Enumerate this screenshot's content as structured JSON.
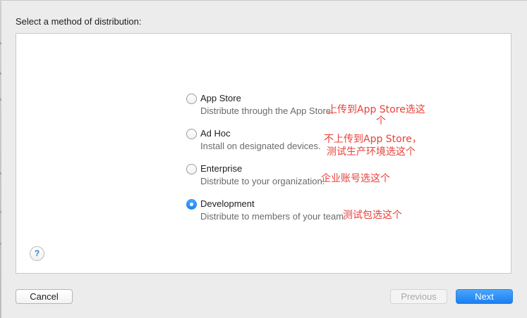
{
  "heading": "Select a method of distribution:",
  "options": [
    {
      "title": "App Store",
      "description": "Distribute through the App Store.",
      "selected": false
    },
    {
      "title": "Ad Hoc",
      "description": "Install on designated devices.",
      "selected": false
    },
    {
      "title": "Enterprise",
      "description": "Distribute to your organization.",
      "selected": false
    },
    {
      "title": "Development",
      "description": "Distribute to members of your team.",
      "selected": true
    }
  ],
  "annotations": {
    "app_store_line1": "上传到App Store选这",
    "app_store_line2": "个",
    "ad_hoc_line1": "不上传到App Store，",
    "ad_hoc_line2": "测试生产环境选这个",
    "enterprise": "企业账号选这个",
    "development": "测试包选这个"
  },
  "help": {
    "label": "?"
  },
  "buttons": {
    "cancel": "Cancel",
    "previous": "Previous",
    "next": "Next"
  },
  "colors": {
    "accent": "#1e86f0",
    "annotation": "#e8413a"
  }
}
